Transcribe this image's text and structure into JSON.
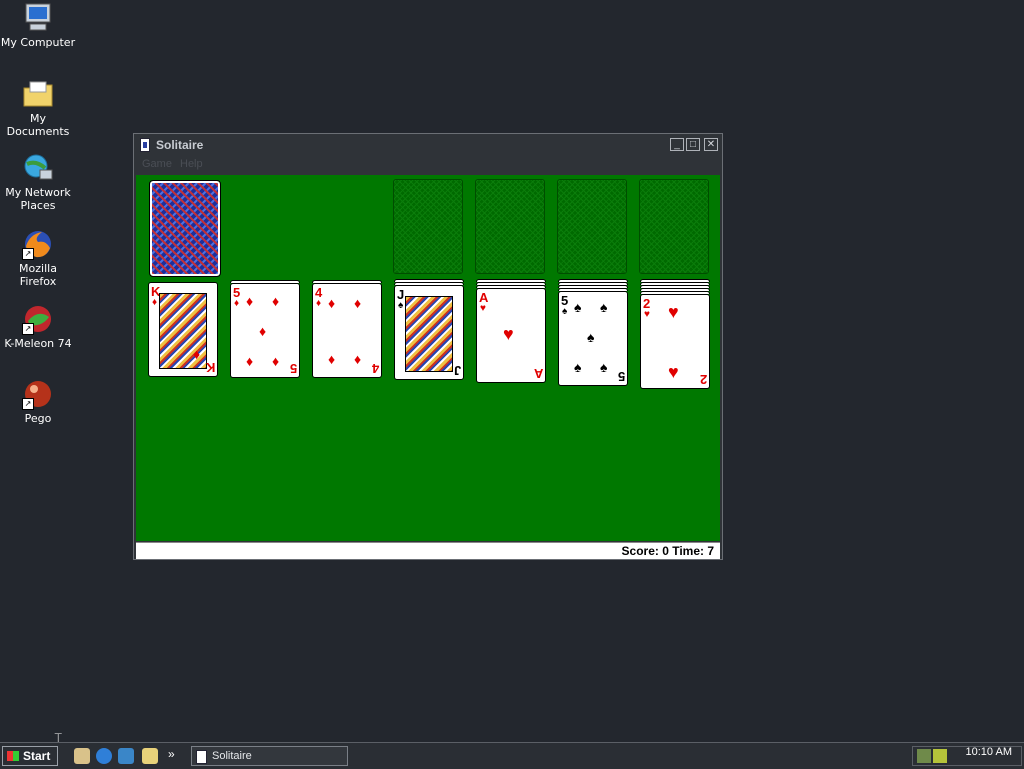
{
  "desktop": {
    "icons": [
      {
        "label": "My Computer",
        "icon": "computer-icon"
      },
      {
        "label": "My Documents",
        "icon": "folder-icon"
      },
      {
        "label": "My Network Places",
        "icon": "network-icon"
      },
      {
        "label": "Mozilla Firefox",
        "icon": "firefox-icon"
      },
      {
        "label": "K-Meleon 74",
        "icon": "kmeleon-icon"
      },
      {
        "label": "Pego",
        "icon": "pego-icon"
      }
    ]
  },
  "window": {
    "title": "Solitaire",
    "menu": [
      "Game",
      "Help"
    ],
    "controls": {
      "minimize": "_",
      "maximize": "□",
      "close": "✕"
    }
  },
  "game": {
    "stock": {
      "face_down": true
    },
    "foundations": [
      {
        "empty": true
      },
      {
        "empty": true
      },
      {
        "empty": true
      },
      {
        "empty": true
      }
    ],
    "tableau": [
      {
        "rank": "K",
        "suit": "♦",
        "color": "red"
      },
      {
        "rank": "5",
        "suit": "♦",
        "color": "red"
      },
      {
        "rank": "4",
        "suit": "♦",
        "color": "red"
      },
      {
        "rank": "J",
        "suit": "♠",
        "color": "black"
      },
      {
        "rank": "A",
        "suit": "♥",
        "color": "red"
      },
      {
        "rank": "5",
        "suit": "♠",
        "color": "black"
      },
      {
        "rank": "2",
        "suit": "♥",
        "color": "red"
      }
    ],
    "status": "Score: 0 Time: 7"
  },
  "taskbar": {
    "start_label": "Start",
    "quick_launch_more": "»",
    "task_label": "Solitaire",
    "clock": "10:10 AM"
  },
  "colors": {
    "desktop": "#23272e",
    "felt": "#007800",
    "card_red": "#e00000"
  }
}
